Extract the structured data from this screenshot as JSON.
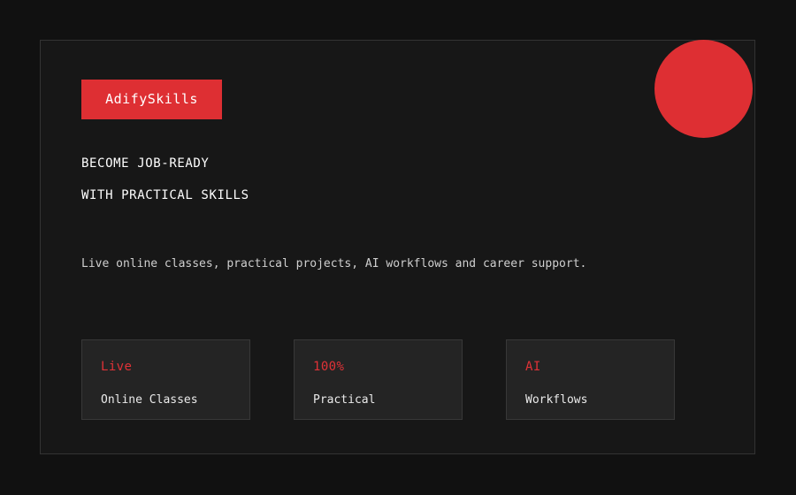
{
  "brand": {
    "label": "AdifySkills"
  },
  "hero": {
    "headline_line1": "BECOME JOB-READY",
    "headline_line2": "WITH PRACTICAL SKILLS",
    "description": "Live online classes, practical projects, AI workflows and career support."
  },
  "stats": [
    {
      "value": "Live",
      "label": "Online Classes"
    },
    {
      "value": "100%",
      "label": "Practical"
    },
    {
      "value": "AI",
      "label": "Workflows"
    }
  ],
  "colors": {
    "accent": "#de2f33",
    "background": "#111111",
    "card": "#171717",
    "stat_card": "#242424"
  }
}
